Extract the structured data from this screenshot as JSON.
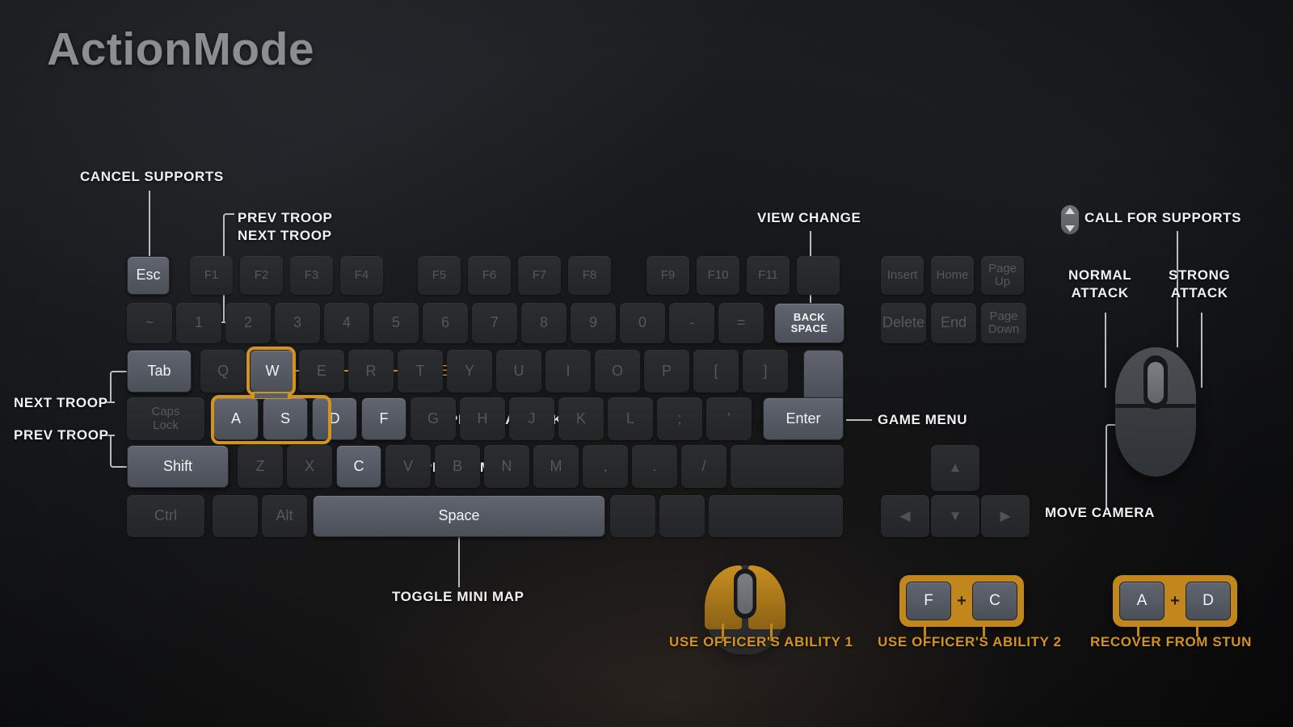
{
  "page": {
    "title": "ActionMode",
    "accent": "#d4921f",
    "key_lit_color": "#5a5f69",
    "key_dim_color": "#2a2c2f",
    "background": "#131416"
  },
  "keyboard": {
    "function_row": [
      {
        "label": "Esc",
        "state": "lit"
      },
      {
        "label": "F1",
        "state": "dim"
      },
      {
        "label": "F2",
        "state": "dim"
      },
      {
        "label": "F3",
        "state": "dim"
      },
      {
        "label": "F4",
        "state": "dim"
      },
      {
        "label": "F5",
        "state": "dim"
      },
      {
        "label": "F6",
        "state": "dim"
      },
      {
        "label": "F7",
        "state": "dim"
      },
      {
        "label": "F8",
        "state": "dim"
      },
      {
        "label": "F9",
        "state": "dim"
      },
      {
        "label": "F10",
        "state": "dim"
      },
      {
        "label": "F11",
        "state": "dim"
      },
      {
        "label": "",
        "state": "dim"
      },
      {
        "label": "Insert",
        "state": "dim"
      },
      {
        "label": "Home",
        "state": "dim"
      },
      {
        "label": "Page\nUp",
        "state": "dim"
      }
    ],
    "number_row": [
      {
        "label": "~",
        "state": "dim"
      },
      {
        "label": "1",
        "state": "dim"
      },
      {
        "label": "2",
        "state": "dim"
      },
      {
        "label": "3",
        "state": "dim"
      },
      {
        "label": "4",
        "state": "dim"
      },
      {
        "label": "5",
        "state": "dim"
      },
      {
        "label": "6",
        "state": "dim"
      },
      {
        "label": "7",
        "state": "dim"
      },
      {
        "label": "8",
        "state": "dim"
      },
      {
        "label": "9",
        "state": "dim"
      },
      {
        "label": "0",
        "state": "dim"
      },
      {
        "label": "-",
        "state": "dim"
      },
      {
        "label": "=",
        "state": "dim"
      },
      {
        "label": "BACK SPACE",
        "state": "lit"
      },
      {
        "label": "Delete",
        "state": "dim"
      },
      {
        "label": "End",
        "state": "dim"
      },
      {
        "label": "Page\nDown",
        "state": "dim"
      }
    ],
    "qwerty_row": [
      {
        "label": "Tab",
        "state": "lit"
      },
      {
        "label": "Q",
        "state": "dim"
      },
      {
        "label": "W",
        "state": "lit"
      },
      {
        "label": "E",
        "state": "dim"
      },
      {
        "label": "R",
        "state": "dim"
      },
      {
        "label": "T",
        "state": "dim"
      },
      {
        "label": "Y",
        "state": "dim"
      },
      {
        "label": "U",
        "state": "dim"
      },
      {
        "label": "I",
        "state": "dim"
      },
      {
        "label": "O",
        "state": "dim"
      },
      {
        "label": "P",
        "state": "dim"
      },
      {
        "label": "[",
        "state": "dim"
      },
      {
        "label": "]",
        "state": "dim"
      }
    ],
    "home_row": [
      {
        "label": "Caps\nLock",
        "state": "dim"
      },
      {
        "label": "A",
        "state": "lit"
      },
      {
        "label": "S",
        "state": "lit"
      },
      {
        "label": "D",
        "state": "lit"
      },
      {
        "label": "F",
        "state": "lit"
      },
      {
        "label": "G",
        "state": "dim"
      },
      {
        "label": "H",
        "state": "dim"
      },
      {
        "label": "J",
        "state": "dim"
      },
      {
        "label": "K",
        "state": "dim"
      },
      {
        "label": "L",
        "state": "dim"
      },
      {
        "label": ";",
        "state": "dim"
      },
      {
        "label": "'",
        "state": "dim"
      },
      {
        "label": "Enter",
        "state": "lit"
      }
    ],
    "shift_row": [
      {
        "label": "Shift",
        "state": "lit"
      },
      {
        "label": "Z",
        "state": "dim"
      },
      {
        "label": "X",
        "state": "dim"
      },
      {
        "label": "C",
        "state": "lit"
      },
      {
        "label": "V",
        "state": "dim"
      },
      {
        "label": "B",
        "state": "dim"
      },
      {
        "label": "N",
        "state": "dim"
      },
      {
        "label": "M",
        "state": "dim"
      },
      {
        "label": ",",
        "state": "dim"
      },
      {
        "label": ".",
        "state": "dim"
      },
      {
        "label": "/",
        "state": "dim"
      },
      {
        "label": "",
        "state": "dim"
      }
    ],
    "bottom_row": [
      {
        "label": "Ctrl",
        "state": "dim"
      },
      {
        "label": "",
        "state": "dim"
      },
      {
        "label": "Alt",
        "state": "dim"
      },
      {
        "label": "Space",
        "state": "lit"
      },
      {
        "label": "",
        "state": "dim"
      },
      {
        "label": "",
        "state": "dim"
      },
      {
        "label": "",
        "state": "dim"
      }
    ],
    "arrow_keys": [
      {
        "label": "▲",
        "state": "dim",
        "name": "arrow-up-key"
      },
      {
        "label": "◀",
        "state": "dim",
        "name": "arrow-left-key"
      },
      {
        "label": "▼",
        "state": "dim",
        "name": "arrow-down-key"
      },
      {
        "label": "▶",
        "state": "dim",
        "name": "arrow-right-key"
      }
    ]
  },
  "callouts": {
    "cancel_supports": "CANCEL SUPPORTS",
    "prev_troop_top": "PREV TROOP",
    "next_troop_top": "NEXT TROOP",
    "view_change": "VIEW CHANGE",
    "call_for_supports": "CALL FOR SUPPORTS",
    "normal_attack": "NORMAL\nATTACK",
    "strong_attack": "STRONG\nATTACK",
    "next_troop_left": "NEXT TROOP",
    "prev_troop_left": "PREV TROOP",
    "move": "MOVE",
    "special_attack": "SPECIAL ATTACK",
    "special_move": "SPECIAL MOVE",
    "game_menu": "GAME MENU",
    "move_camera": "MOVE CAMERA",
    "toggle_mini_map": "TOGGLE MINI MAP"
  },
  "combos": {
    "ability1": {
      "label": "USE OFFICER'S ABILITY 1",
      "input": "mouse-left-and-right-click"
    },
    "ability2": {
      "label": "USE OFFICER'S ABILITY 2",
      "key_a": "F",
      "plus": "+",
      "key_b": "C"
    },
    "recover": {
      "label": "RECOVER FROM STUN",
      "key_a": "A",
      "plus": "+",
      "key_b": "D"
    }
  }
}
